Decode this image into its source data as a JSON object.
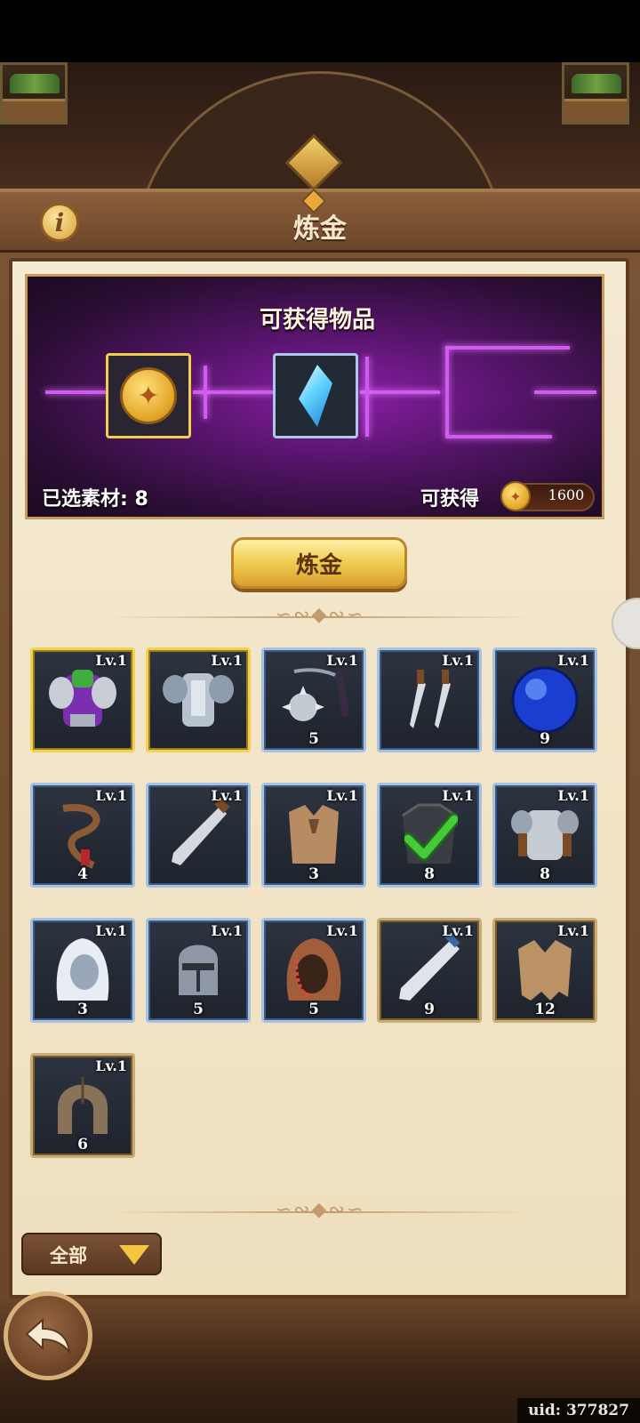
{
  "window": {
    "title": "炼金"
  },
  "banner": {
    "title": "可获得物品",
    "materials_label": "已选素材: 8",
    "obtain_label": "可获得",
    "obtain_value": "1600",
    "rewards": [
      {
        "name": "coin-icon"
      },
      {
        "name": "crystal-icon"
      }
    ]
  },
  "actions": {
    "alchemy_label": "炼金"
  },
  "items": [
    {
      "lv": "Lv.1",
      "count": "",
      "rarity": "epic",
      "icon": "purple-armor-icon",
      "checked": false
    },
    {
      "lv": "Lv.1",
      "count": "",
      "rarity": "epic",
      "icon": "silver-armor-icon",
      "checked": false
    },
    {
      "lv": "Lv.1",
      "count": "5",
      "rarity": "rare",
      "icon": "flail-icon",
      "checked": false
    },
    {
      "lv": "Lv.1",
      "count": "",
      "rarity": "rare",
      "icon": "daggers-icon",
      "checked": false
    },
    {
      "lv": "Lv.1",
      "count": "9",
      "rarity": "rare",
      "icon": "blue-orb-icon",
      "checked": false
    },
    {
      "lv": "Lv.1",
      "count": "4",
      "rarity": "rare",
      "icon": "rope-whip-icon",
      "checked": false
    },
    {
      "lv": "Lv.1",
      "count": "",
      "rarity": "rare",
      "icon": "sword-icon",
      "checked": false
    },
    {
      "lv": "Lv.1",
      "count": "3",
      "rarity": "rare",
      "icon": "cloth-vest-icon",
      "checked": false
    },
    {
      "lv": "Lv.1",
      "count": "8",
      "rarity": "rare",
      "icon": "chainmail-icon",
      "checked": true
    },
    {
      "lv": "Lv.1",
      "count": "8",
      "rarity": "rare",
      "icon": "plate-armor-icon",
      "checked": false
    },
    {
      "lv": "Lv.1",
      "count": "3",
      "rarity": "rare",
      "icon": "white-hood-icon",
      "checked": false
    },
    {
      "lv": "Lv.1",
      "count": "5",
      "rarity": "rare",
      "icon": "knight-helmet-icon",
      "checked": false
    },
    {
      "lv": "Lv.1",
      "count": "5",
      "rarity": "rare",
      "icon": "leather-hood-icon",
      "checked": false
    },
    {
      "lv": "Lv.1",
      "count": "9",
      "rarity": "common",
      "icon": "steel-sword-icon",
      "checked": false
    },
    {
      "lv": "Lv.1",
      "count": "12",
      "rarity": "common",
      "icon": "tattered-vest-icon",
      "checked": false
    },
    {
      "lv": "Lv.1",
      "count": "6",
      "rarity": "common",
      "icon": "cloth-helmet-icon",
      "checked": false
    }
  ],
  "filter": {
    "selected": "全部"
  },
  "footer": {
    "uid": "uid: 377827"
  },
  "colors": {
    "accent": "#f2d14e",
    "banner_glow": "#d35af0",
    "panel": "#f5ead2"
  }
}
